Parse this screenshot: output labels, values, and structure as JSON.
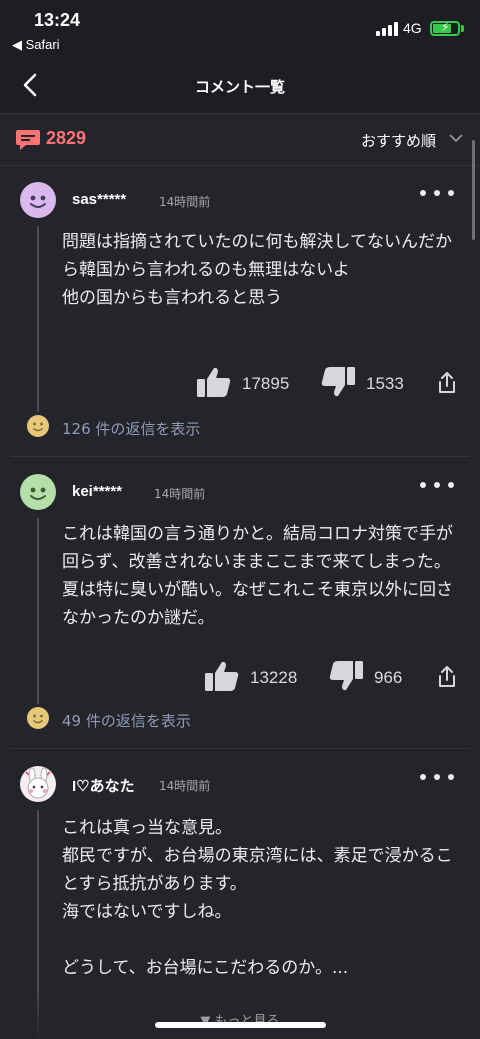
{
  "status_bar": {
    "time": "13:24",
    "back_app": "◀ Safari",
    "network": "4G"
  },
  "nav": {
    "title": "コメント一覧"
  },
  "summary": {
    "count": "2829",
    "sort_label": "おすすめ順"
  },
  "comments": [
    {
      "user": "sas*****",
      "time": "14時間前",
      "body": "問題は指摘されていたのに何も解決してないんだから韓国から言われるのも無理はないよ\n他の国からも言われると思う",
      "likes": "17895",
      "dislikes": "1533",
      "replies": "126 件の返信を表示"
    },
    {
      "user": "kei*****",
      "time": "14時間前",
      "body": "これは韓国の言う通りかと。結局コロナ対策で手が回らず、改善されないままここまで来てしまった。夏は特に臭いが酷い。なぜこれこそ東京以外に回さなかったのか謎だ。",
      "likes": "13228",
      "dislikes": "966",
      "replies": "49 件の返信を表示"
    },
    {
      "user": "I♡あなた",
      "time": "14時間前",
      "body": "これは真っ当な意見。\n都民ですが、お台場の東京湾には、素足で浸かることすら抵抗があります。\n海ではないですしね。\n\nどうして、お台場にこだわるのか。..."
    }
  ],
  "footer": {
    "more": "▼ もっと見る"
  },
  "colors": {
    "background": "#24252b",
    "accent": "#ff7373",
    "reply_link": "#8f9ab3",
    "battery": "#36c94b"
  }
}
